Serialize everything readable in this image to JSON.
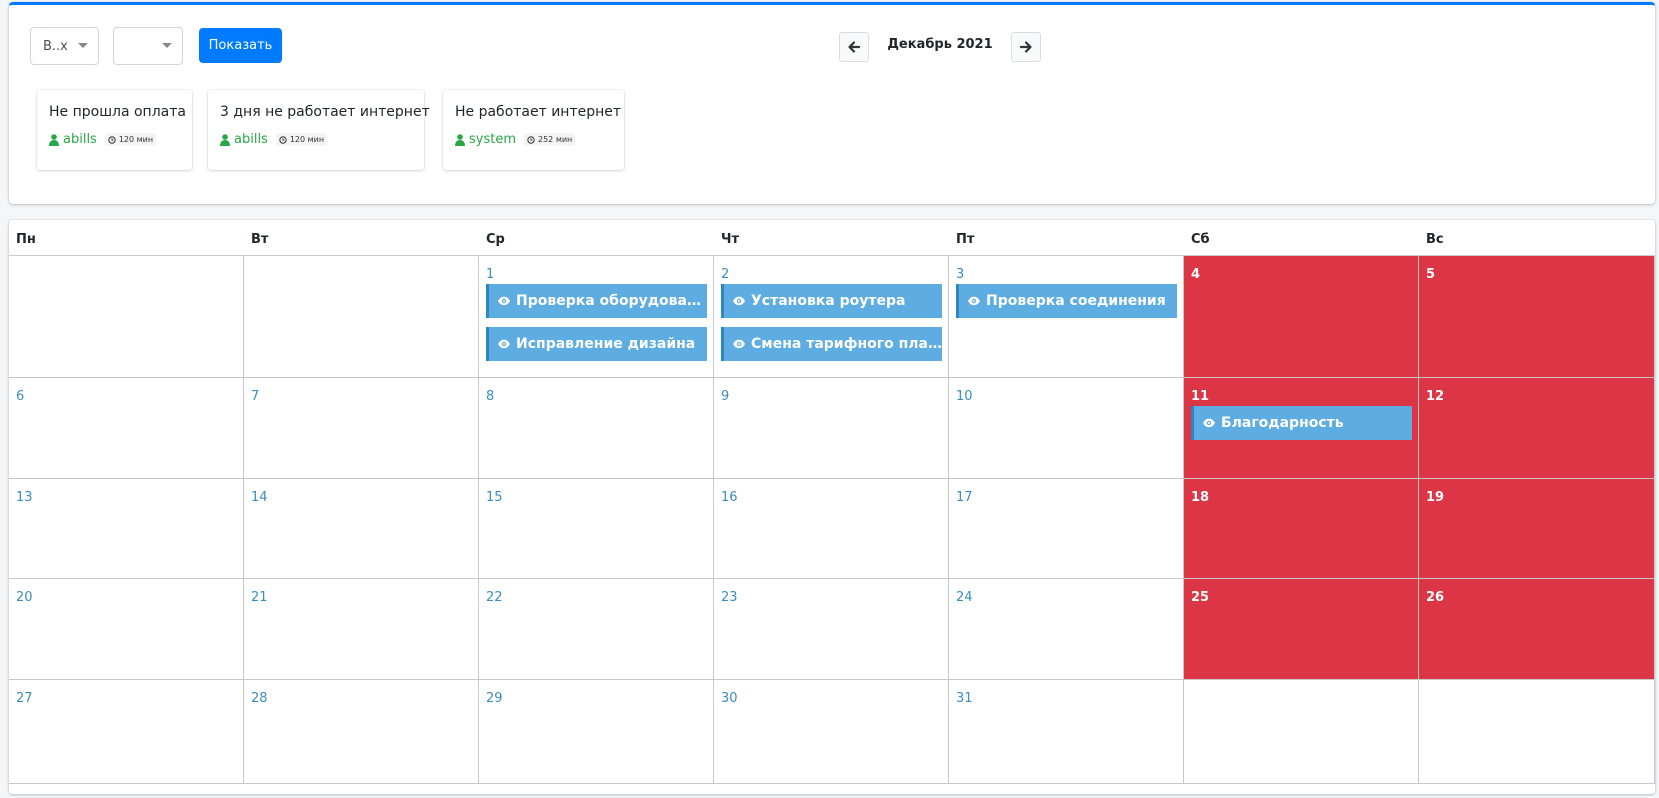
{
  "filters": {
    "select1_value": "В..х",
    "select2_value": "",
    "show_label": "Показать"
  },
  "nav": {
    "month_title": "Декабрь 2021"
  },
  "tasks": [
    {
      "title": "Не прошла оплата",
      "user": "abills",
      "time": "120 мин"
    },
    {
      "title": "3 дня не работает интернет",
      "user": "abills",
      "time": "120 мин"
    },
    {
      "title": "Не работает интернет",
      "user": "system",
      "time": "252 мин"
    }
  ],
  "calendar": {
    "day_names": [
      "Пн",
      "Вт",
      "Ср",
      "Чт",
      "Пт",
      "Сб",
      "Вс"
    ],
    "weeks": [
      [
        "",
        "",
        "1",
        "2",
        "3",
        "4",
        "5"
      ],
      [
        "6",
        "7",
        "8",
        "9",
        "10",
        "11",
        "12"
      ],
      [
        "13",
        "14",
        "15",
        "16",
        "17",
        "18",
        "19"
      ],
      [
        "20",
        "21",
        "22",
        "23",
        "24",
        "25",
        "26"
      ],
      [
        "27",
        "28",
        "29",
        "30",
        "31",
        "",
        ""
      ]
    ],
    "events": {
      "d1": [
        "Проверка оборудования",
        "Исправление дизайна"
      ],
      "d2": [
        "Установка роутера",
        "Смена тарифного плана на более выгодный"
      ],
      "d3": [
        "Проверка соединения"
      ],
      "d11": [
        "Благодарность"
      ]
    }
  },
  "colors": {
    "primary": "#007bff",
    "weekend": "#dc3545",
    "event": "#5dade2",
    "user": "#28a745",
    "day_number": "#3c8dbc"
  }
}
